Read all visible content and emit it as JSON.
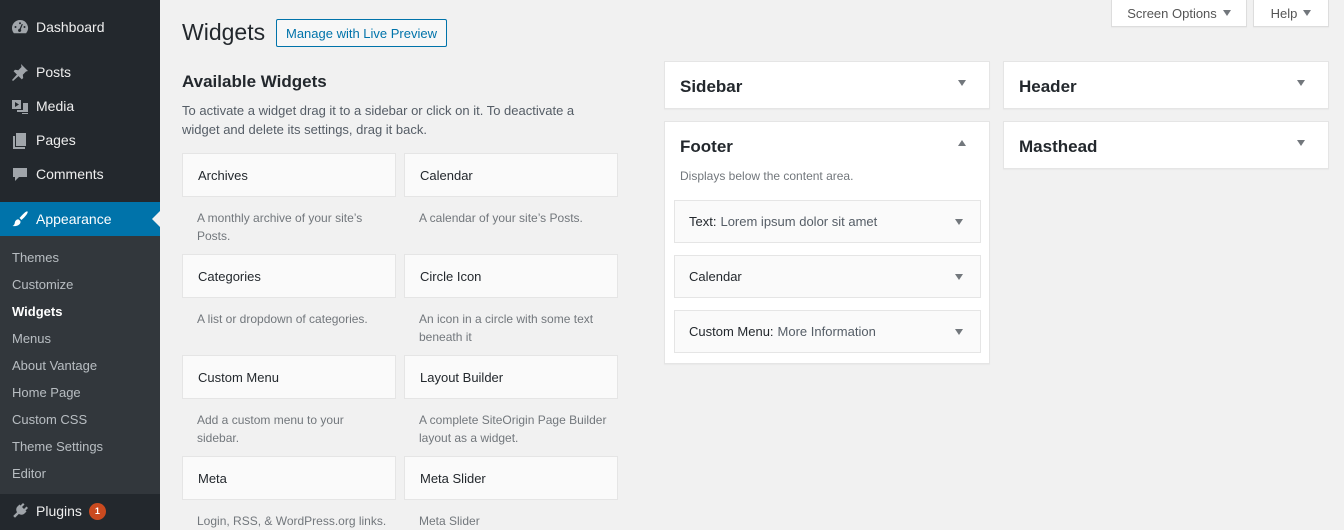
{
  "admin_menu": {
    "items": [
      {
        "label": "Dashboard",
        "icon": "dashboard-icon"
      },
      {
        "label": "Posts",
        "icon": "pushpin-icon"
      },
      {
        "label": "Media",
        "icon": "media-icon"
      },
      {
        "label": "Pages",
        "icon": "pages-icon"
      },
      {
        "label": "Comments",
        "icon": "comment-icon"
      },
      {
        "label": "Appearance",
        "icon": "paintbrush-icon"
      },
      {
        "label": "Plugins",
        "icon": "plugin-icon",
        "badge": "1"
      }
    ],
    "submenu": [
      "Themes",
      "Customize",
      "Widgets",
      "Menus",
      "About Vantage",
      "Home Page",
      "Custom CSS",
      "Theme Settings",
      "Editor"
    ],
    "current_submenu": "Widgets"
  },
  "screen_meta": {
    "screen_options": "Screen Options",
    "help": "Help"
  },
  "header": {
    "title": "Widgets",
    "live_preview": "Manage with Live Preview"
  },
  "available": {
    "title": "Available Widgets",
    "description": "To activate a widget drag it to a sidebar or click on it. To deactivate a widget and delete its settings, drag it back.",
    "widgets": [
      {
        "title": "Archives",
        "desc": "A monthly archive of your site’s Posts."
      },
      {
        "title": "Calendar",
        "desc": "A calendar of your site’s Posts."
      },
      {
        "title": "Categories",
        "desc": "A list or dropdown of categories."
      },
      {
        "title": "Circle Icon",
        "desc": "An icon in a circle with some text beneath it"
      },
      {
        "title": "Custom Menu",
        "desc": "Add a custom menu to your sidebar."
      },
      {
        "title": "Layout Builder",
        "desc": "A complete SiteOrigin Page Builder layout as a widget."
      },
      {
        "title": "Meta",
        "desc": "Login, RSS, & WordPress.org links."
      },
      {
        "title": "Meta Slider",
        "desc": "Meta Slider"
      }
    ]
  },
  "sidebars": {
    "sidebar": {
      "title": "Sidebar"
    },
    "footer": {
      "title": "Footer",
      "description": "Displays below the content area.",
      "widgets": [
        {
          "name": "Text:",
          "in_title": "Lorem ipsum dolor sit amet"
        },
        {
          "name": "Calendar",
          "in_title": ""
        },
        {
          "name": "Custom Menu:",
          "in_title": "More Information"
        }
      ]
    },
    "header": {
      "title": "Header"
    },
    "masthead": {
      "title": "Masthead"
    }
  },
  "colors": {
    "menu_bg": "#23282d",
    "submenu_bg": "#32373c",
    "accent": "#0073aa",
    "badge": "#ca4a1f",
    "page_bg": "#f1f1f1"
  }
}
